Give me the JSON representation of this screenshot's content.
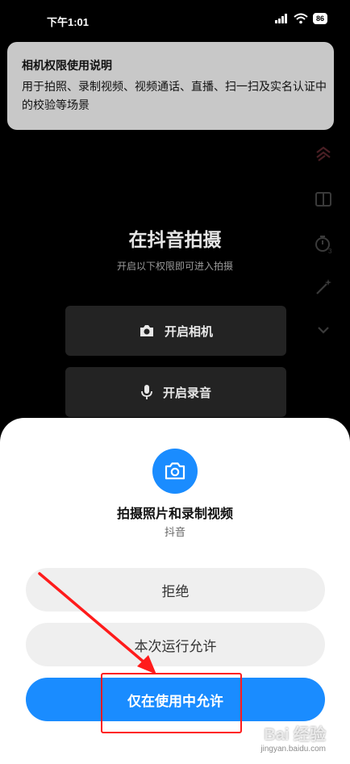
{
  "status_bar": {
    "time": "下午1:01",
    "battery": "86"
  },
  "notice": {
    "title": "相机权限使用说明",
    "body": "用于拍照、录制视频、视频通话、直播、扫一扫及实名认证中的校验等场景"
  },
  "side_tools": [
    "flip-icon",
    "layout-icon",
    "timer-icon",
    "magic-wand-icon",
    "chevron-down-icon"
  ],
  "main": {
    "title": "在抖音拍摄",
    "subtitle": "开启以下权限即可进入拍摄",
    "camera_button": "开启相机",
    "mic_button": "开启录音"
  },
  "dialog": {
    "title": "拍摄照片和录制视频",
    "app_name": "抖音",
    "buttons": {
      "deny": "拒绝",
      "allow_once": "本次运行允许",
      "allow_while_using": "仅在使用中允许"
    }
  },
  "colors": {
    "accent": "#1a8cff",
    "annotation": "#ff1b1b"
  },
  "watermark": {
    "logo": "Bai 经验",
    "url": "jingyan.baidu.com"
  }
}
